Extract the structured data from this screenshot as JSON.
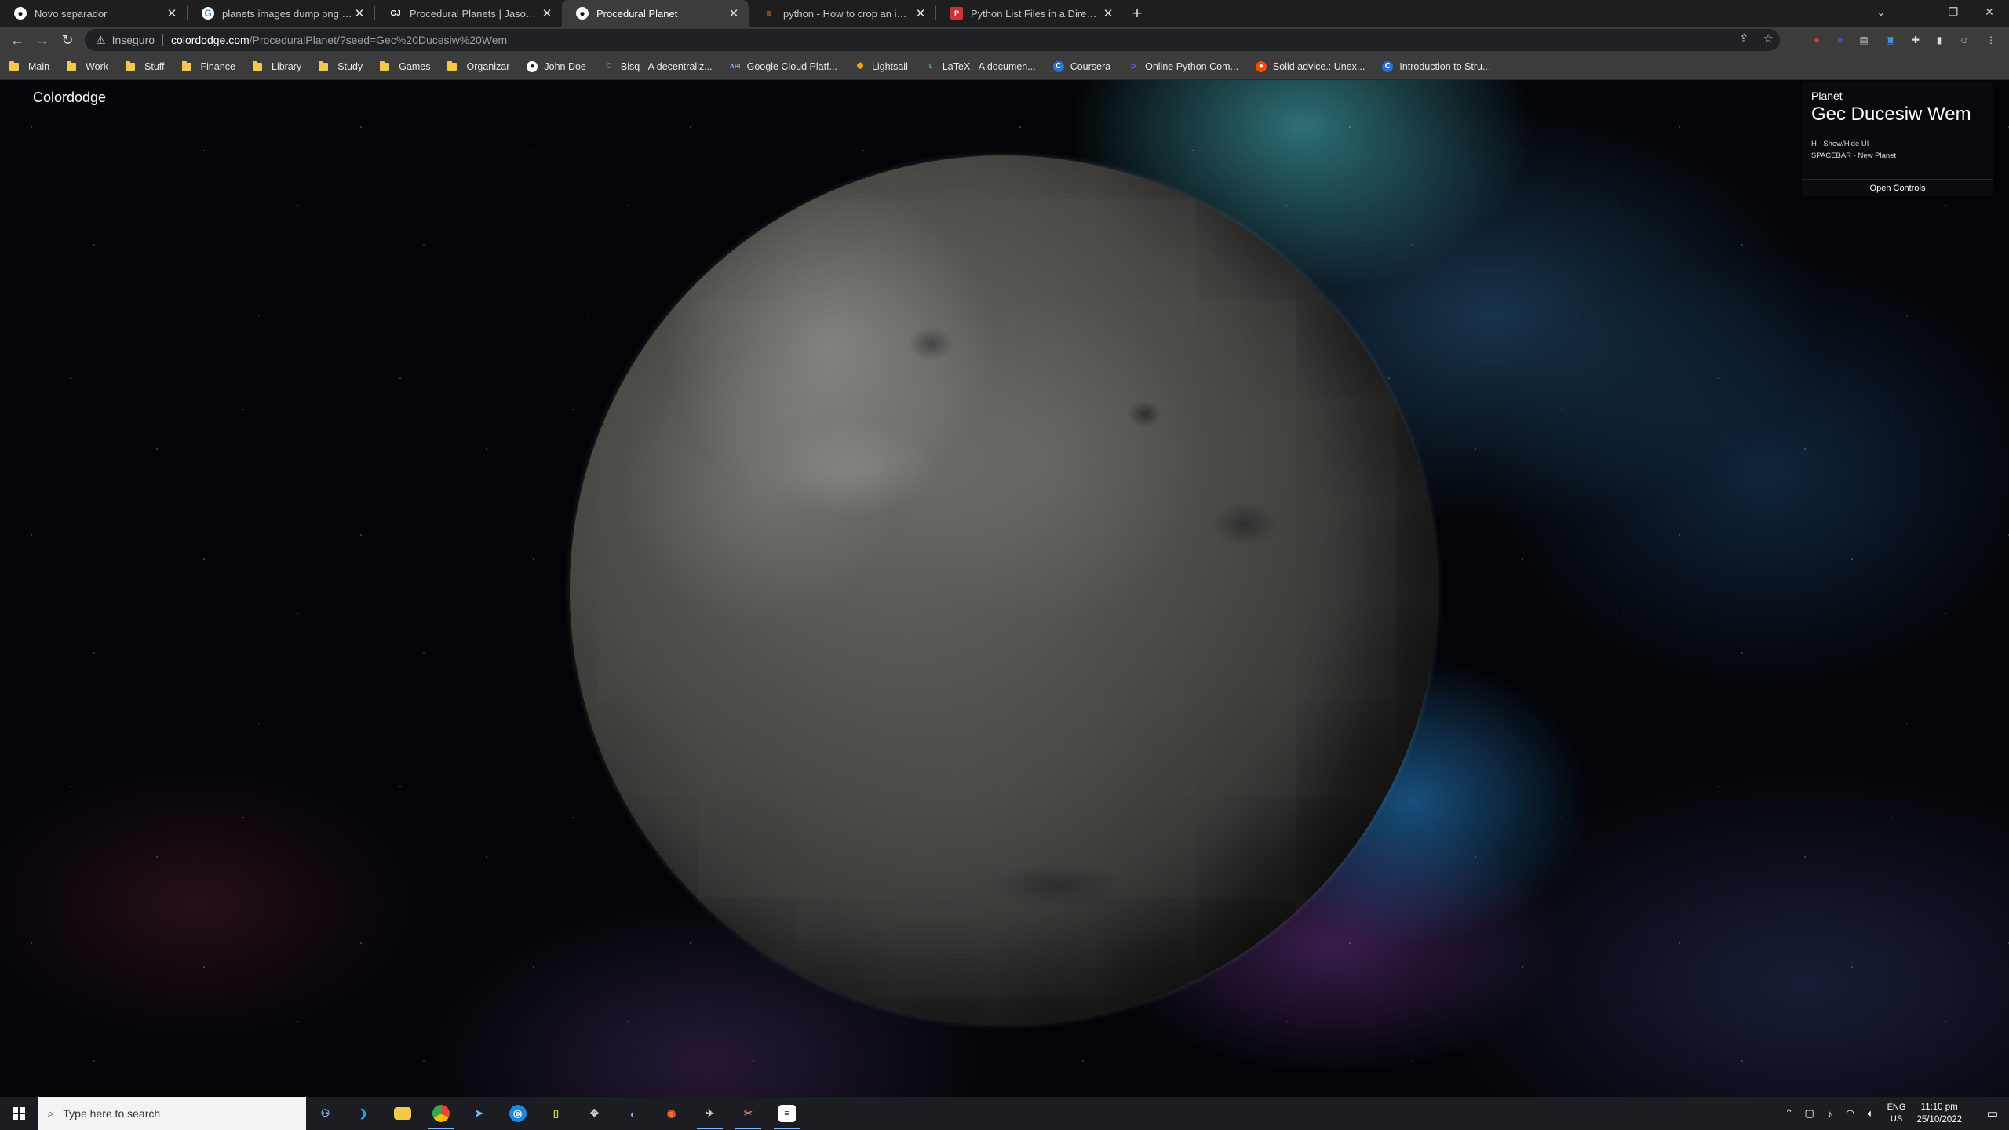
{
  "browser": {
    "tabs": [
      {
        "title": "Novo separador",
        "favicon": "github-icon",
        "active": false
      },
      {
        "title": "planets images dump png - Goo",
        "favicon": "google-icon",
        "active": false
      },
      {
        "title": "Procedural Planets | Jason K. Sm",
        "favicon": "jk-icon",
        "active": false
      },
      {
        "title": "Procedural Planet",
        "favicon": "github-icon",
        "active": true
      },
      {
        "title": "python - How to crop an image",
        "favicon": "stackoverflow-icon",
        "active": false
      },
      {
        "title": "Python List Files in a Directory [5",
        "favicon": "pynative-icon",
        "active": false
      }
    ],
    "security_label": "Inseguro",
    "url_host": "colordodge.com",
    "url_path": "/ProceduralPlanet/?seed=Gec%20Ducesiw%20Wem",
    "bookmarks": [
      {
        "label": "Main",
        "type": "folder"
      },
      {
        "label": "Work",
        "type": "folder"
      },
      {
        "label": "Stuff",
        "type": "folder"
      },
      {
        "label": "Finance",
        "type": "folder"
      },
      {
        "label": "Library",
        "type": "folder"
      },
      {
        "label": "Study",
        "type": "folder"
      },
      {
        "label": "Games",
        "type": "folder"
      },
      {
        "label": "Organizar",
        "type": "folder"
      },
      {
        "label": "John Doe",
        "type": "site",
        "icon": "github-icon"
      },
      {
        "label": "Bisq - A decentraliz...",
        "type": "site",
        "icon": "bisq-icon"
      },
      {
        "label": "Google Cloud Platf...",
        "type": "site",
        "icon": "api-icon"
      },
      {
        "label": "Lightsail",
        "type": "site",
        "icon": "aws-icon"
      },
      {
        "label": "LaTeX - A documen...",
        "type": "site",
        "icon": "latex-icon"
      },
      {
        "label": "Coursera",
        "type": "site",
        "icon": "coursera-icon"
      },
      {
        "label": "Online Python Com...",
        "type": "site",
        "icon": "python-icon"
      },
      {
        "label": "Solid advice.: Unex...",
        "type": "site",
        "icon": "reddit-icon"
      },
      {
        "label": "Introduction to Stru...",
        "type": "site",
        "icon": "coursera-icon"
      }
    ]
  },
  "page": {
    "site_title": "Colordodge",
    "panel": {
      "label": "Planet",
      "planet_name": "Gec Ducesiw Wem",
      "hint_hide": "H - Show/Hide UI",
      "hint_new": "SPACEBAR - New Planet",
      "open_controls": "Open Controls"
    }
  },
  "taskbar": {
    "search_placeholder": "Type here to search",
    "language": "ENG",
    "region": "US",
    "time": "11:10 pm",
    "date": "25/10/2022"
  }
}
